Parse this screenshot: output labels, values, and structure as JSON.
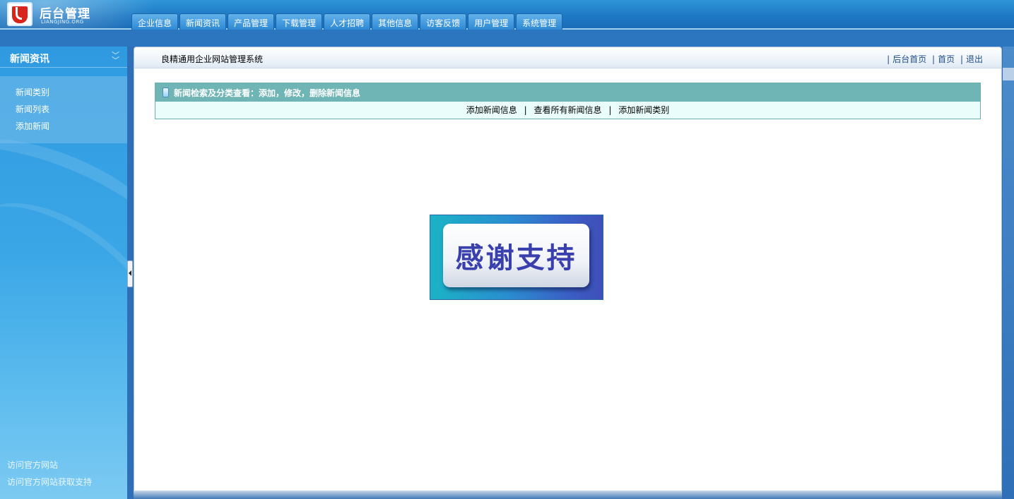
{
  "header": {
    "logo_title": "后台管理",
    "logo_subtitle": "LIANGJING.ORG",
    "nav_tabs": [
      "企业信息",
      "新闻资讯",
      "产品管理",
      "下载管理",
      "人才招聘",
      "其他信息",
      "访客反馈",
      "用户管理",
      "系统管理"
    ]
  },
  "sidebar": {
    "title": "新闻资讯",
    "items": [
      "新闻类别",
      "新闻列表",
      "添加新闻"
    ],
    "footer_links": [
      "访问官方网站",
      "访问官方网站获取支持"
    ]
  },
  "main": {
    "title": "良精通用企业网站管理系统",
    "top_links": [
      "后台首页",
      "首页",
      "退出"
    ],
    "top_link_separator": "|",
    "panel": {
      "title": "新闻检索及分类查看：添加，修改，删除新闻信息",
      "links": [
        "添加新闻信息",
        "查看所有新闻信息",
        "添加新闻类别"
      ],
      "separator": "|"
    },
    "banner_text": "感谢支持"
  },
  "colors": {
    "header_blue": "#1d78c4",
    "sidebar_blue": "#3aa6e6",
    "panel_teal": "#6fb5b5",
    "panel_body": "#eafdfb",
    "link_blue": "#1e4a85",
    "banner_text": "#3a3fae"
  }
}
